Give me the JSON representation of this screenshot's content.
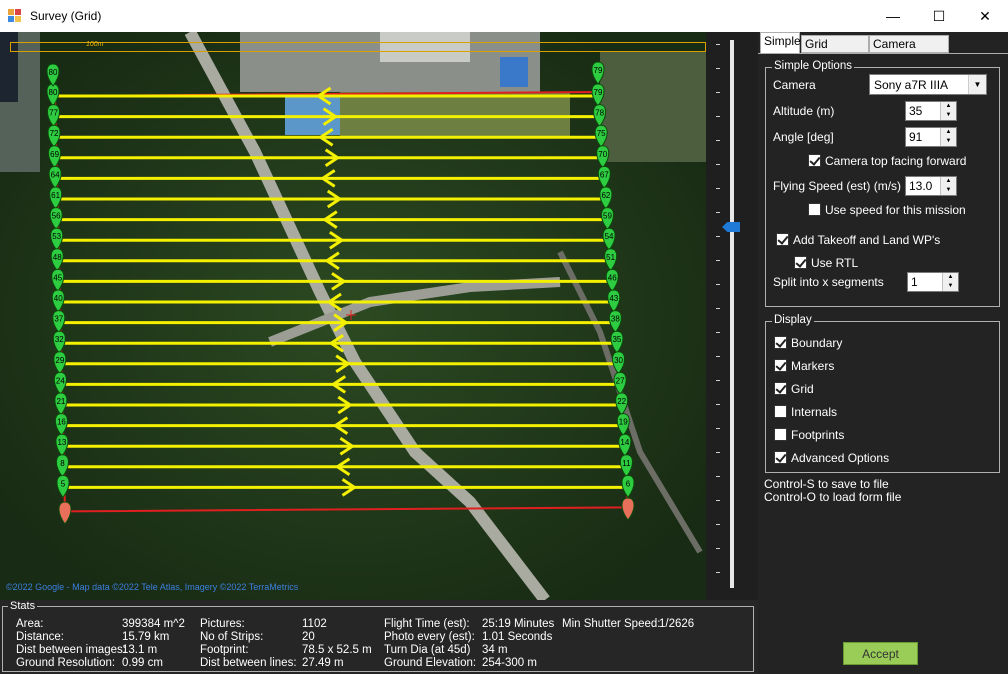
{
  "window": {
    "title": "Survey (Grid)",
    "minimize": "—",
    "maximize": "☐",
    "close": "✕"
  },
  "map": {
    "scale_label": "100m",
    "copyright": "©2022 Google - Map data ©2022 Tele Atlas, Imagery ©2022 TerraMetrics",
    "waypoint_labels_left": [
      "80",
      "77",
      "72",
      "69",
      "64",
      "61",
      "56",
      "53",
      "48",
      "45",
      "40",
      "37",
      "32",
      "29",
      "24",
      "21",
      "16",
      "13",
      "8",
      "5"
    ],
    "waypoint_labels_right": [
      "79",
      "78",
      "75",
      "70",
      "67",
      "62",
      "59",
      "54",
      "51",
      "46",
      "43",
      "38",
      "35",
      "30",
      "27",
      "22",
      "19",
      "14",
      "11",
      "6",
      "3"
    ]
  },
  "stats": {
    "title": "Stats",
    "area_label": "Area:",
    "area_value": "399384 m^2",
    "distance_label": "Distance:",
    "distance_value": "15.79 km",
    "dist_images_label": "Dist between images:",
    "dist_images_value": "13.1 m",
    "ground_res_label": "Ground Resolution:",
    "ground_res_value": "0.99 cm",
    "pictures_label": "Pictures:",
    "pictures_value": "1102",
    "strips_label": "No of Strips:",
    "strips_value": "20",
    "footprint_label": "Footprint:",
    "footprint_value": "78.5 x 52.5 m",
    "dist_lines_label": "Dist between lines:",
    "dist_lines_value": "27.49 m",
    "flight_time_label": "Flight Time (est):",
    "flight_time_value": "25:19 Minutes",
    "photo_every_label": "Photo every (est):",
    "photo_every_value": "1.01 Seconds",
    "turn_dia_label": "Turn Dia (at 45d)",
    "turn_dia_value": "34 m",
    "ground_elev_label": "Ground Elevation:",
    "ground_elev_value": "254-300 m",
    "shutter_label": "Min Shutter Speed:",
    "shutter_value": "1/2626"
  },
  "tabs": [
    "Simple",
    "Grid Options",
    "Camera Config"
  ],
  "simple": {
    "group_title": "Simple Options",
    "camera_label": "Camera",
    "camera_value": "Sony a7R IIIA",
    "altitude_label": "Altitude (m)",
    "altitude_value": "35",
    "angle_label": "Angle [deg]",
    "angle_value": "91",
    "camera_top_label": "Camera top facing forward",
    "speed_label": "Flying Speed (est) (m/s)",
    "speed_value": "13.0",
    "use_speed_label": "Use speed for this mission",
    "takeoff_label": "Add Takeoff and Land WP's",
    "rtl_label": "Use RTL",
    "split_label": "Split into x segments",
    "split_value": "1"
  },
  "display": {
    "group_title": "Display",
    "boundary": "Boundary",
    "markers": "Markers",
    "grid": "Grid",
    "internals": "Internals",
    "footprints": "Footprints",
    "advanced": "Advanced Options"
  },
  "hints": {
    "save": "Control-S to save to file",
    "load": "Control-O to load form file"
  },
  "accept_label": "Accept"
}
